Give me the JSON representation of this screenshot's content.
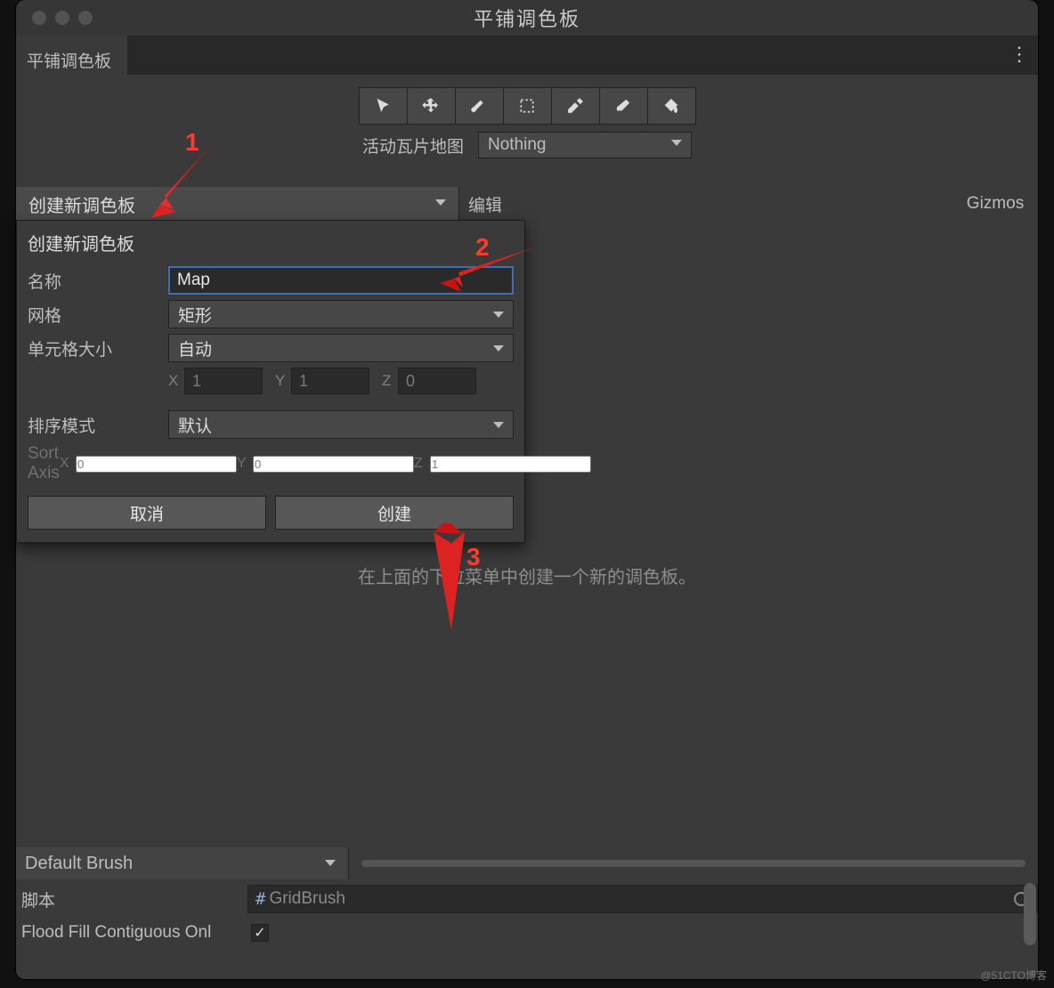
{
  "window": {
    "title": "平铺调色板",
    "tab": "平铺调色板"
  },
  "toolbar": {
    "tools": [
      "select",
      "move",
      "brush",
      "box",
      "eyedropper",
      "eraser",
      "fill"
    ],
    "active_tilemap_label": "活动瓦片地图",
    "active_tilemap_value": "Nothing"
  },
  "palette_row": {
    "dropdown_label": "创建新调色板",
    "edit_label": "编辑",
    "gizmos_label": "Gizmos"
  },
  "popup": {
    "title": "创建新调色板",
    "fields": {
      "name_label": "名称",
      "name_value": "Map",
      "grid_label": "网格",
      "grid_value": "矩形",
      "cellsize_label": "单元格大小",
      "cellsize_value": "自动",
      "cell_x": "1",
      "cell_y": "1",
      "cell_z": "0",
      "sortmode_label": "排序模式",
      "sortmode_value": "默认",
      "sortaxis_label": "Sort Axis",
      "axis_x": "0",
      "axis_y": "0",
      "axis_z": "1"
    },
    "buttons": {
      "cancel": "取消",
      "create": "创建"
    }
  },
  "hint": "在上面的下拉菜单中创建一个新的调色板。",
  "bottom": {
    "brush_name": "Default Brush",
    "script_label": "脚本",
    "script_value": "GridBrush",
    "floodfill_label": "Flood Fill Contiguous Onl",
    "floodfill_checked": true
  },
  "annotations": {
    "a1": "1",
    "a2": "2",
    "a3": "3"
  },
  "watermark": "@51CTO博客"
}
